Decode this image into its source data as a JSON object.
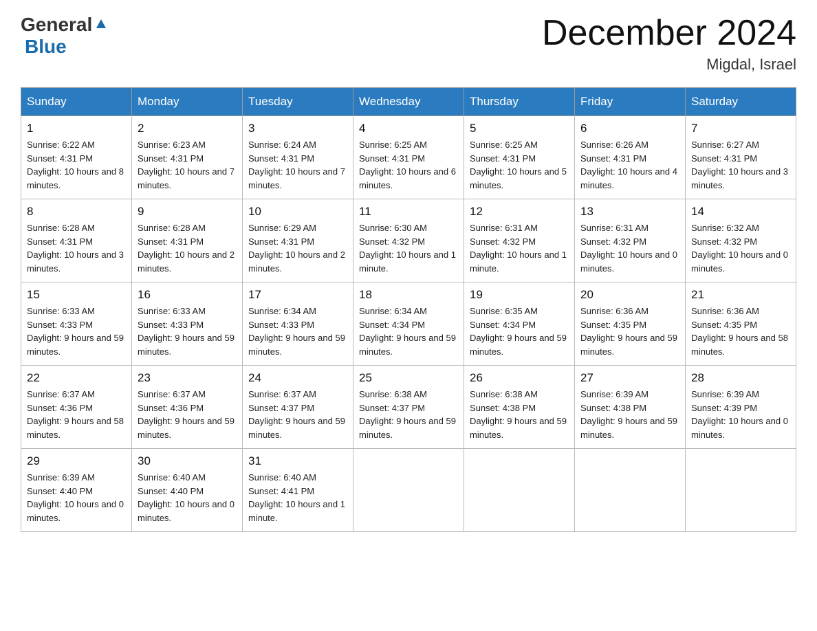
{
  "header": {
    "logo_general": "General",
    "logo_blue": "Blue",
    "month_title": "December 2024",
    "location": "Migdal, Israel"
  },
  "weekdays": [
    "Sunday",
    "Monday",
    "Tuesday",
    "Wednesday",
    "Thursday",
    "Friday",
    "Saturday"
  ],
  "weeks": [
    [
      {
        "day": "1",
        "sunrise": "6:22 AM",
        "sunset": "4:31 PM",
        "daylight": "10 hours and 8 minutes."
      },
      {
        "day": "2",
        "sunrise": "6:23 AM",
        "sunset": "4:31 PM",
        "daylight": "10 hours and 7 minutes."
      },
      {
        "day": "3",
        "sunrise": "6:24 AM",
        "sunset": "4:31 PM",
        "daylight": "10 hours and 7 minutes."
      },
      {
        "day": "4",
        "sunrise": "6:25 AM",
        "sunset": "4:31 PM",
        "daylight": "10 hours and 6 minutes."
      },
      {
        "day": "5",
        "sunrise": "6:25 AM",
        "sunset": "4:31 PM",
        "daylight": "10 hours and 5 minutes."
      },
      {
        "day": "6",
        "sunrise": "6:26 AM",
        "sunset": "4:31 PM",
        "daylight": "10 hours and 4 minutes."
      },
      {
        "day": "7",
        "sunrise": "6:27 AM",
        "sunset": "4:31 PM",
        "daylight": "10 hours and 3 minutes."
      }
    ],
    [
      {
        "day": "8",
        "sunrise": "6:28 AM",
        "sunset": "4:31 PM",
        "daylight": "10 hours and 3 minutes."
      },
      {
        "day": "9",
        "sunrise": "6:28 AM",
        "sunset": "4:31 PM",
        "daylight": "10 hours and 2 minutes."
      },
      {
        "day": "10",
        "sunrise": "6:29 AM",
        "sunset": "4:31 PM",
        "daylight": "10 hours and 2 minutes."
      },
      {
        "day": "11",
        "sunrise": "6:30 AM",
        "sunset": "4:32 PM",
        "daylight": "10 hours and 1 minute."
      },
      {
        "day": "12",
        "sunrise": "6:31 AM",
        "sunset": "4:32 PM",
        "daylight": "10 hours and 1 minute."
      },
      {
        "day": "13",
        "sunrise": "6:31 AM",
        "sunset": "4:32 PM",
        "daylight": "10 hours and 0 minutes."
      },
      {
        "day": "14",
        "sunrise": "6:32 AM",
        "sunset": "4:32 PM",
        "daylight": "10 hours and 0 minutes."
      }
    ],
    [
      {
        "day": "15",
        "sunrise": "6:33 AM",
        "sunset": "4:33 PM",
        "daylight": "9 hours and 59 minutes."
      },
      {
        "day": "16",
        "sunrise": "6:33 AM",
        "sunset": "4:33 PM",
        "daylight": "9 hours and 59 minutes."
      },
      {
        "day": "17",
        "sunrise": "6:34 AM",
        "sunset": "4:33 PM",
        "daylight": "9 hours and 59 minutes."
      },
      {
        "day": "18",
        "sunrise": "6:34 AM",
        "sunset": "4:34 PM",
        "daylight": "9 hours and 59 minutes."
      },
      {
        "day": "19",
        "sunrise": "6:35 AM",
        "sunset": "4:34 PM",
        "daylight": "9 hours and 59 minutes."
      },
      {
        "day": "20",
        "sunrise": "6:36 AM",
        "sunset": "4:35 PM",
        "daylight": "9 hours and 59 minutes."
      },
      {
        "day": "21",
        "sunrise": "6:36 AM",
        "sunset": "4:35 PM",
        "daylight": "9 hours and 58 minutes."
      }
    ],
    [
      {
        "day": "22",
        "sunrise": "6:37 AM",
        "sunset": "4:36 PM",
        "daylight": "9 hours and 58 minutes."
      },
      {
        "day": "23",
        "sunrise": "6:37 AM",
        "sunset": "4:36 PM",
        "daylight": "9 hours and 59 minutes."
      },
      {
        "day": "24",
        "sunrise": "6:37 AM",
        "sunset": "4:37 PM",
        "daylight": "9 hours and 59 minutes."
      },
      {
        "day": "25",
        "sunrise": "6:38 AM",
        "sunset": "4:37 PM",
        "daylight": "9 hours and 59 minutes."
      },
      {
        "day": "26",
        "sunrise": "6:38 AM",
        "sunset": "4:38 PM",
        "daylight": "9 hours and 59 minutes."
      },
      {
        "day": "27",
        "sunrise": "6:39 AM",
        "sunset": "4:38 PM",
        "daylight": "9 hours and 59 minutes."
      },
      {
        "day": "28",
        "sunrise": "6:39 AM",
        "sunset": "4:39 PM",
        "daylight": "10 hours and 0 minutes."
      }
    ],
    [
      {
        "day": "29",
        "sunrise": "6:39 AM",
        "sunset": "4:40 PM",
        "daylight": "10 hours and 0 minutes."
      },
      {
        "day": "30",
        "sunrise": "6:40 AM",
        "sunset": "4:40 PM",
        "daylight": "10 hours and 0 minutes."
      },
      {
        "day": "31",
        "sunrise": "6:40 AM",
        "sunset": "4:41 PM",
        "daylight": "10 hours and 1 minute."
      },
      null,
      null,
      null,
      null
    ]
  ]
}
